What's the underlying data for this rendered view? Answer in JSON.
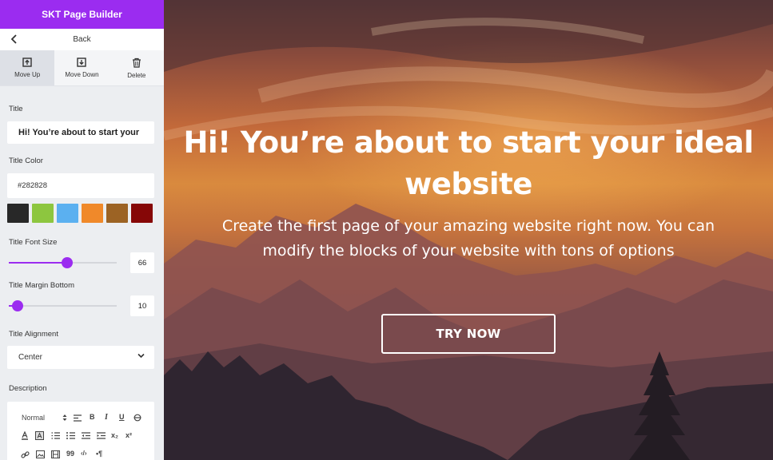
{
  "app": {
    "title": "SKT Page Builder",
    "accent": "#9b2cf0"
  },
  "nav": {
    "back_label": "Back"
  },
  "actions": [
    {
      "label": "Move Up",
      "icon": "move-up-icon"
    },
    {
      "label": "Move Down",
      "icon": "move-down-icon"
    },
    {
      "label": "Delete",
      "icon": "trash-icon"
    }
  ],
  "fields": {
    "title_label": "Title",
    "title_value": "Hi! You’re about to start your",
    "title_color_label": "Title Color",
    "title_color_value": "#282828",
    "swatches": [
      "#282828",
      "#8dc63f",
      "#5bb0f0",
      "#f0892a",
      "#9c6324",
      "#860707"
    ],
    "font_size_label": "Title Font Size",
    "font_size_value": "66",
    "font_size_level": 0.54,
    "margin_bottom_label": "Title Margin Bottom",
    "margin_bottom_value": "10",
    "margin_bottom_level": 0.08,
    "alignment_label": "Title Alignment",
    "alignment_value": "Center",
    "description_label": "Description"
  },
  "editor_toolbar": {
    "format_value": "Normal",
    "bold": "B",
    "italic": "I",
    "underline": "U",
    "subscript": "x₂",
    "superscript": "x²",
    "code": "‹/›",
    "quote": "99",
    "rtl": "•¶"
  },
  "hero": {
    "title": "Hi! You’re about to start your ideal website",
    "description": "Create the  first page of your amazing website right now. You can modify the blocks of your website with tons of options",
    "cta_label": "TRY NOW"
  }
}
